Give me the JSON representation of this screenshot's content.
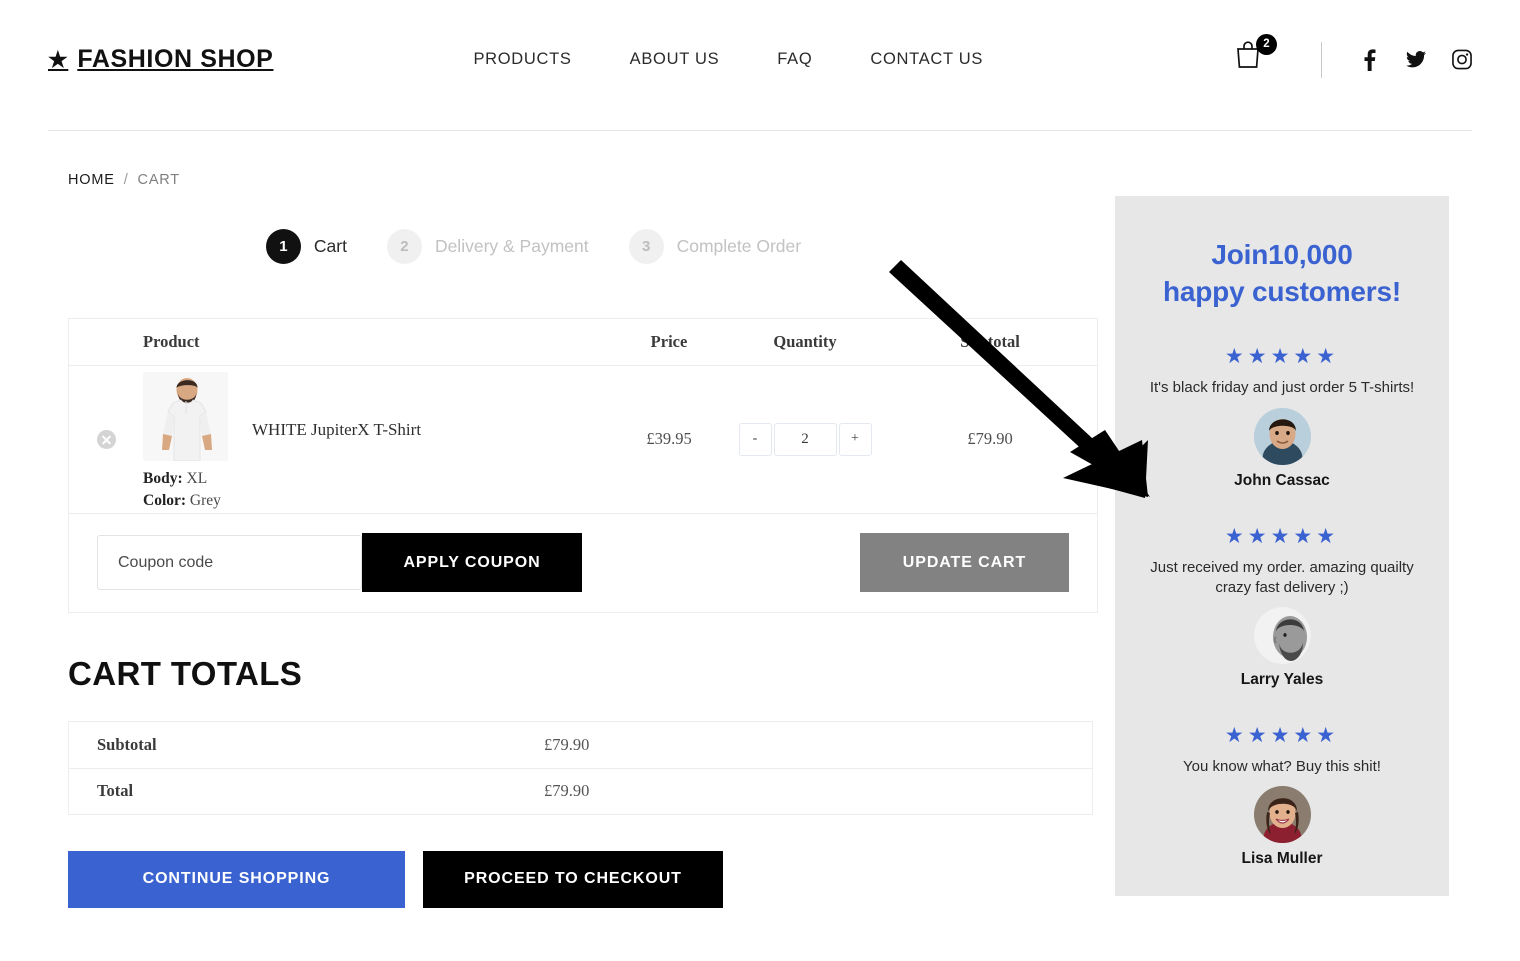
{
  "header": {
    "logo_star": "★",
    "logo_text": "FASHION SHOP",
    "nav": [
      {
        "label": "PRODUCTS"
      },
      {
        "label": "ABOUT US"
      },
      {
        "label": "FAQ"
      },
      {
        "label": "CONTACT US"
      }
    ],
    "cart_count": "2",
    "socials": [
      "facebook-icon",
      "twitter-icon",
      "instagram-icon"
    ]
  },
  "breadcrumb": {
    "home": "HOME",
    "separator": "/",
    "current": "CART"
  },
  "steps": [
    {
      "num": "1",
      "label": "Cart",
      "state": "active"
    },
    {
      "num": "2",
      "label": "Delivery & Payment",
      "state": "idle"
    },
    {
      "num": "3",
      "label": "Complete Order",
      "state": "idle"
    }
  ],
  "cart_table": {
    "columns": {
      "product": "Product",
      "price": "Price",
      "quantity": "Quantity",
      "subtotal": "Subtotal"
    },
    "row": {
      "name": "WHITE JupiterX T-Shirt",
      "body_label": "Body:",
      "body_value": "XL",
      "color_label": "Color:",
      "color_value": "Grey",
      "price": "£39.95",
      "qty_minus": "-",
      "qty_value": "2",
      "qty_plus": "+",
      "subtotal": "£79.90"
    },
    "coupon_placeholder": "Coupon code",
    "coupon_value": "",
    "apply_coupon_label": "APPLY COUPON",
    "update_cart_label": "UPDATE CART"
  },
  "totals": {
    "title": "CART TOTALS",
    "rows": [
      {
        "label": "Subtotal",
        "value": "£79.90"
      },
      {
        "label": "Total",
        "value": "£79.90"
      }
    ]
  },
  "actions": {
    "continue_label": "CONTINUE SHOPPING",
    "checkout_label": "PROCEED TO CHECKOUT"
  },
  "sidebar": {
    "title_line1": "Join10,000",
    "title_line2": "happy customers!",
    "testimonials": [
      {
        "stars": "★★★★★",
        "text": "It's black friday and just order 5 T-shirts!",
        "name": "John Cassac"
      },
      {
        "stars": "★★★★★",
        "text": "Just received my order. amazing quailty crazy fast delivery ;)",
        "name": "Larry Yales"
      },
      {
        "stars": "★★★★★",
        "text": "You know what? Buy this shit!",
        "name": "Lisa Muller"
      }
    ]
  },
  "colors": {
    "accent_blue": "#3a62d0",
    "black": "#000000",
    "sidebar_bg": "#e7e7e7",
    "update_grey": "#828282"
  }
}
